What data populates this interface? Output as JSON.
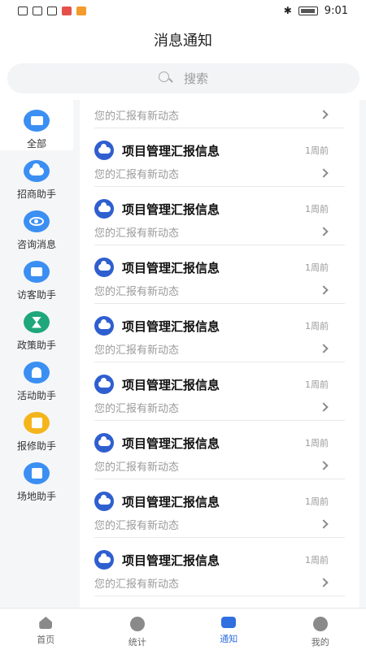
{
  "status": {
    "time": "9:01"
  },
  "header": {
    "title": "消息通知"
  },
  "search": {
    "placeholder": "搜索"
  },
  "sidebar": {
    "items": [
      {
        "label": "全部",
        "icon": "folder-icon"
      },
      {
        "label": "招商助手",
        "icon": "cloud-icon"
      },
      {
        "label": "咨询消息",
        "icon": "eye-icon"
      },
      {
        "label": "访客助手",
        "icon": "flag-icon"
      },
      {
        "label": "政策助手",
        "icon": "hourglass-icon"
      },
      {
        "label": "活动助手",
        "icon": "bell-icon"
      },
      {
        "label": "报修助手",
        "icon": "trash-icon"
      },
      {
        "label": "场地助手",
        "icon": "bag-icon"
      }
    ]
  },
  "messages": {
    "partial_desc": "您的汇报有新动态",
    "items": [
      {
        "title": "项目管理汇报信息",
        "time": "1周前",
        "desc": "您的汇报有新动态"
      },
      {
        "title": "项目管理汇报信息",
        "time": "1周前",
        "desc": "您的汇报有新动态"
      },
      {
        "title": "项目管理汇报信息",
        "time": "1周前",
        "desc": "您的汇报有新动态"
      },
      {
        "title": "项目管理汇报信息",
        "time": "1周前",
        "desc": "您的汇报有新动态"
      },
      {
        "title": "项目管理汇报信息",
        "time": "1周前",
        "desc": "您的汇报有新动态"
      },
      {
        "title": "项目管理汇报信息",
        "time": "1周前",
        "desc": "您的汇报有新动态"
      },
      {
        "title": "项目管理汇报信息",
        "time": "1周前",
        "desc": "您的汇报有新动态"
      },
      {
        "title": "项目管理汇报信息",
        "time": "1周前",
        "desc": "您的汇报有新动态"
      }
    ]
  },
  "tabbar": {
    "items": [
      {
        "label": "首页",
        "icon": "home-icon"
      },
      {
        "label": "统计",
        "icon": "chart-icon"
      },
      {
        "label": "通知",
        "icon": "chat-icon"
      },
      {
        "label": "我的",
        "icon": "profile-icon"
      }
    ]
  },
  "colors": {
    "accent": "#2f6fe0",
    "item_icon": "#2f5fcf",
    "sidebar_icon": "#3b8ff2"
  }
}
